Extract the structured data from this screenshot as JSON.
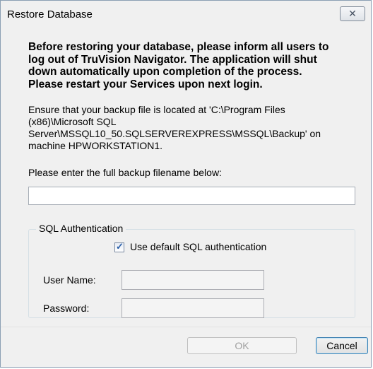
{
  "window": {
    "title": "Restore Database"
  },
  "warning": "Before restoring your database, please inform all users to\nlog out of TruVision Navigator.  The application will shut\ndown automatically upon completion of the process.\nPlease restart your Services upon next login.",
  "info": "Ensure that your backup file is located at 'C:\\Program Files\n(x86)\\Microsoft SQL\nServer\\MSSQL10_50.SQLSERVEREXPRESS\\MSSQL\\Backup' on\nmachine HPWORKSTATION1.",
  "prompt": "Please enter the full backup filename below:",
  "backup_filename": {
    "value": "",
    "placeholder": ""
  },
  "sql_auth": {
    "group_label": "SQL Authentication",
    "use_default_label": "Use default SQL authentication",
    "use_default_checked": true,
    "username_label": "User Name:",
    "password_label": "Password:",
    "username_value": "",
    "password_value": ""
  },
  "buttons": {
    "ok": "OK",
    "cancel": "Cancel"
  }
}
